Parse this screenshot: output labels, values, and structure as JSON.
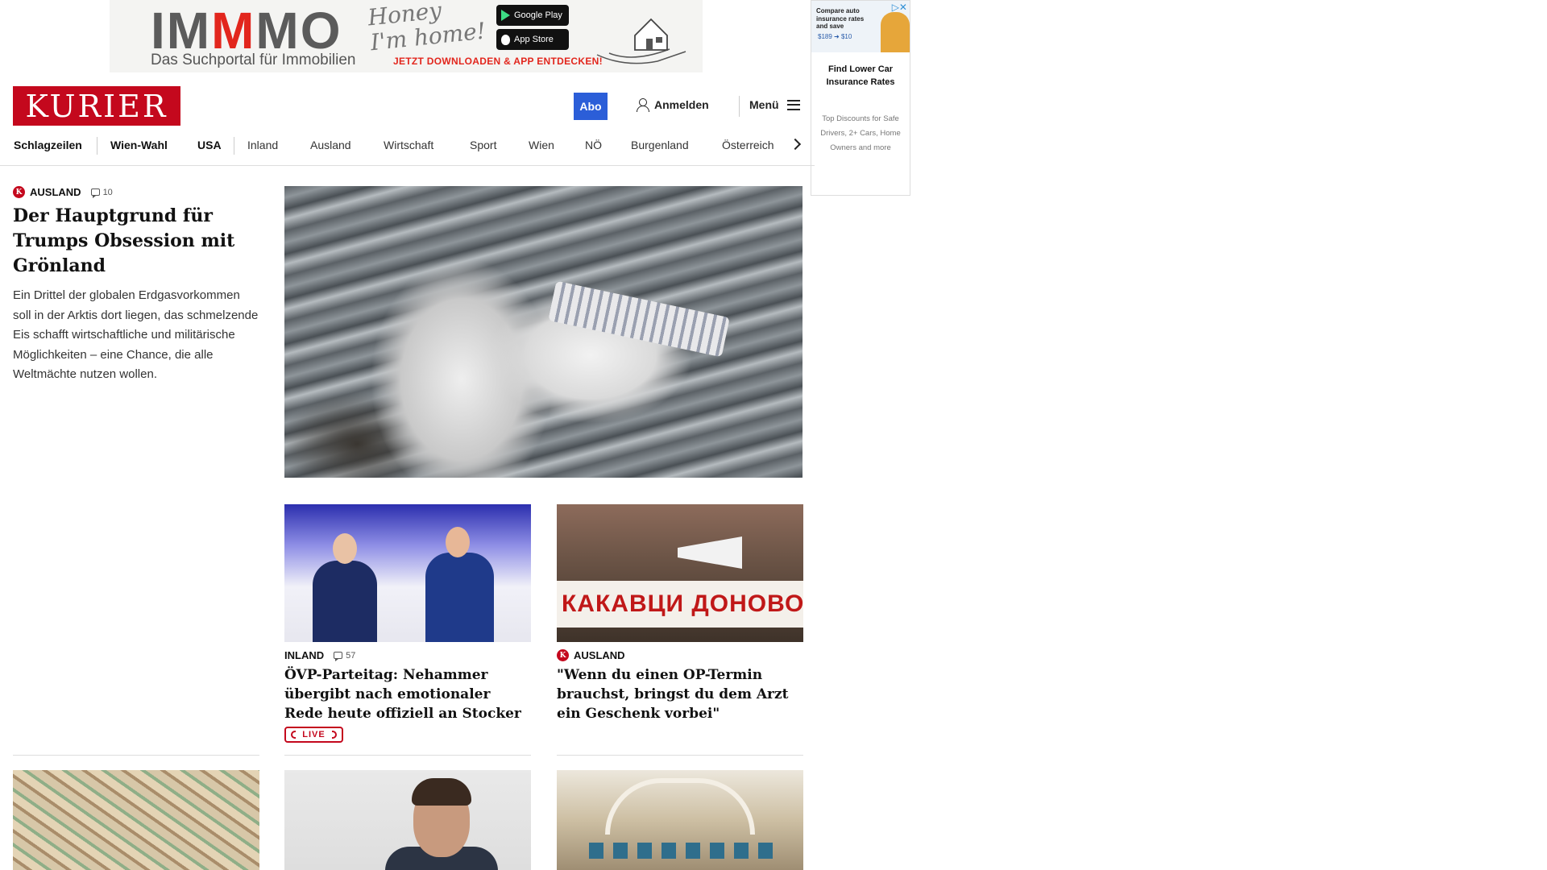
{
  "banner_ad": {
    "brand_part1": "IM",
    "brand_red": "M",
    "brand_part2": "MO",
    "subtitle": "Das Suchportal für Immobilien",
    "script_line1": "Honey",
    "script_line2": "I'm home!",
    "google_play": "Google Play",
    "app_store": "App Store",
    "cta": "JETZT DOWNLOADEN & APP ENTDECKEN!"
  },
  "side_ad": {
    "top_text": "Compare auto insurance rates and save",
    "price": "$189 ➜ $10",
    "close": "▷✕",
    "title": "Find Lower Car Insurance Rates",
    "description": "Top Discounts for Safe Drivers, 2+ Cars, Home Owners and more"
  },
  "header": {
    "logo": "KURIER",
    "abo": "Abo",
    "login": "Anmelden",
    "menu": "Menü"
  },
  "nav": {
    "items": [
      "Schlagzeilen",
      "Wien-Wahl",
      "USA",
      "Inland",
      "Ausland",
      "Wirtschaft",
      "Sport",
      "Wien",
      "NÖ",
      "Burgenland",
      "Österreich"
    ]
  },
  "hero": {
    "category": "AUSLAND",
    "comments": "10",
    "title": "Der Hauptgrund für Trumps Obsession mit Grönland",
    "teaser": "Ein Drittel der globalen Erdgasvorkommen soll in der Arktis dort liegen, das schmelzende Eis schafft wirtschaftliche und militärische Möglichkeiten – eine Chance, die alle Weltmächte nutzen wollen."
  },
  "cards": [
    {
      "category": "INLAND",
      "comments": "57",
      "title": "ÖVP-Parteitag: Nehammer übergibt nach emotionaler Rede heute offiziell an Stocker",
      "badge": "LIVE"
    },
    {
      "category": "AUSLAND",
      "title": "\"Wenn du einen OP-Termin brauchst, bringst du dem Arzt ein Geschenk vorbei\"",
      "image_text": "КАКАВЦИ ДОНОВОСАТ"
    }
  ],
  "colors": {
    "brand_red": "#c4081d",
    "abo_blue": "#2b5ed8"
  }
}
